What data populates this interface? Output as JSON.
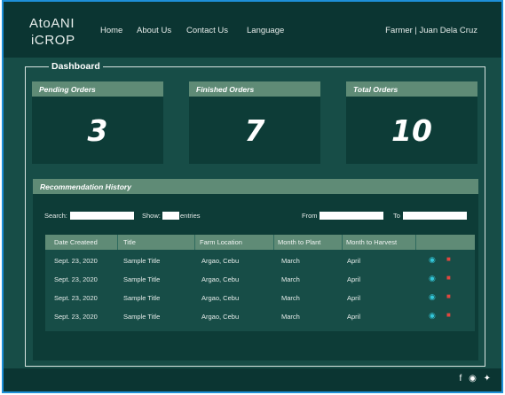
{
  "brand": {
    "line1": "AtoANI",
    "line2": "iCROP"
  },
  "nav": {
    "home": "Home",
    "about": "About Us",
    "contact": "Contact Us",
    "language": "Language"
  },
  "user": "Farmer | Juan Dela Cruz",
  "dashboard_title": "Dashboard",
  "cards": [
    {
      "label": "Pending Orders",
      "value": "3"
    },
    {
      "label": "Finished Orders",
      "value": "7"
    },
    {
      "label": "Total Orders",
      "value": "10"
    }
  ],
  "history": {
    "title": "Recommendation History",
    "search_label": "Search:",
    "show_label": "Show:",
    "entries_label": "entries",
    "from_label": "From",
    "to_label": "To",
    "columns": [
      "Date Createed",
      "Title",
      "Farm Location",
      "Month to Plant",
      "Month to Harvest"
    ],
    "rows": [
      [
        "Sept. 23, 2020",
        "Sample Title",
        "Argao, Cebu",
        "March",
        "April"
      ],
      [
        "Sept. 23, 2020",
        "Sample Title",
        "Argao, Cebu",
        "March",
        "April"
      ],
      [
        "Sept. 23, 2020",
        "Sample Title",
        "Argao, Cebu",
        "March",
        "April"
      ],
      [
        "Sept. 23, 2020",
        "Sample Title",
        "Argao, Cebu",
        "March",
        "April"
      ]
    ]
  },
  "icons": {
    "view": "eye-icon",
    "delete": "trash-icon",
    "social": [
      "facebook-icon",
      "instagram-icon",
      "twitter-icon"
    ]
  },
  "colors": {
    "topbar": "#0b3532",
    "body": "#174d47",
    "header_strip": "#5f8b76",
    "eye": "#32c6d8",
    "trash": "#e2473f"
  }
}
